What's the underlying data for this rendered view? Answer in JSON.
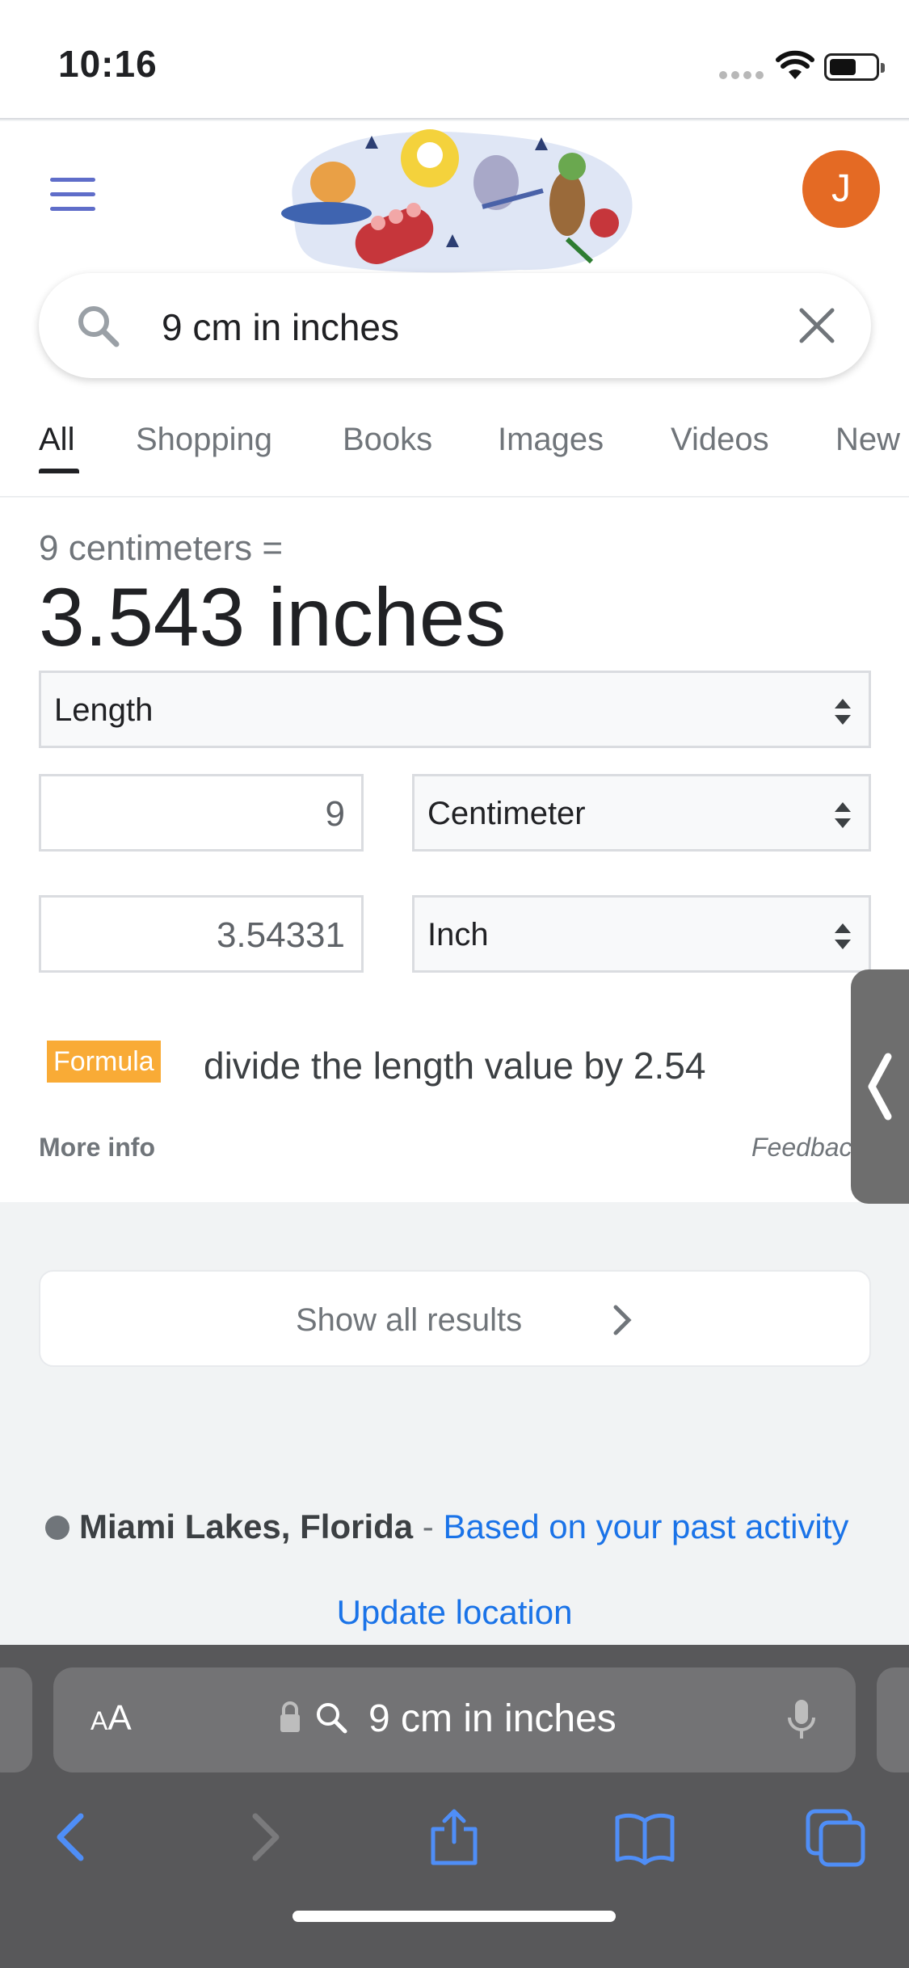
{
  "status_bar": {
    "time": "10:16"
  },
  "header": {
    "avatar_letter": "J",
    "search": {
      "query": "9 cm in inches"
    },
    "tabs": [
      {
        "label": "All",
        "active": true
      },
      {
        "label": "Shopping"
      },
      {
        "label": "Books"
      },
      {
        "label": "Images"
      },
      {
        "label": "Videos"
      },
      {
        "label": "New"
      }
    ]
  },
  "converter": {
    "equation_label": "9 centimeters =",
    "result": "3.543 inches",
    "unit_type": "Length",
    "from_value": "9",
    "from_unit": "Centimeter",
    "to_value": "3.54331",
    "to_unit": "Inch",
    "formula_badge": "Formula",
    "formula_text": "divide the length value by 2.54",
    "more_info": "More info",
    "feedback": "Feedback"
  },
  "show_all": {
    "label": "Show all results"
  },
  "location": {
    "place": "Miami Lakes, Florida",
    "separator": " - ",
    "basis_link": "Based on your past activity",
    "update_link": "Update location"
  },
  "safari": {
    "text_size_big": "A",
    "text_size_small": "A",
    "url_text": "9 cm in inches"
  },
  "colors": {
    "link_blue": "#1a73e8",
    "avatar_orange": "#e46a24",
    "formula_badge": "#f9ab36",
    "safari_toolbar": "#58585a",
    "safari_accent": "#4f8ef7"
  },
  "icons": [
    "menu-icon",
    "search-icon",
    "clear-icon",
    "chevron-right-icon",
    "lock-icon",
    "mic-icon",
    "back-icon",
    "forward-icon",
    "share-icon",
    "bookmarks-icon",
    "tabs-icon"
  ]
}
